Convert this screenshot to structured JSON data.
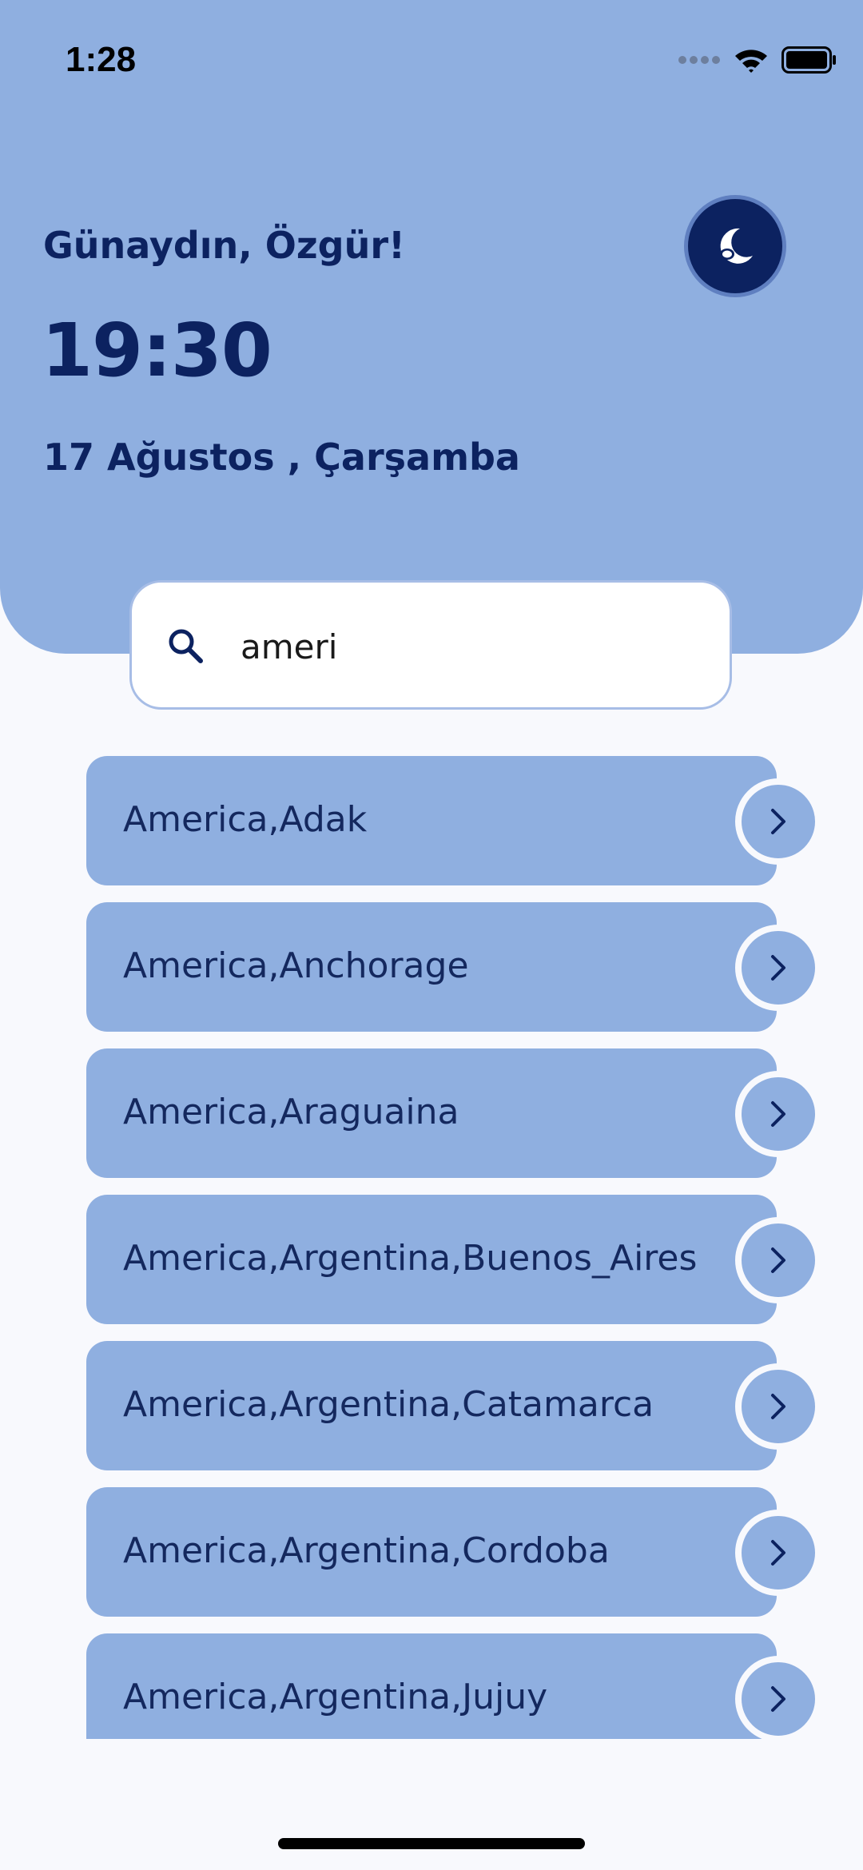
{
  "status_bar": {
    "time": "1:28"
  },
  "header": {
    "greeting": "Günaydın, Özgür!",
    "clock": "19:30",
    "date": "17 Ağustos , Çarşamba",
    "theme_toggle_icon": "moon-icon"
  },
  "search": {
    "value": "ameri",
    "icon": "search-icon"
  },
  "results": [
    {
      "label": "America,Adak"
    },
    {
      "label": "America,Anchorage"
    },
    {
      "label": "America,Araguaina"
    },
    {
      "label": "America,Argentina,Buenos_Aires"
    },
    {
      "label": "America,Argentina,Catamarca"
    },
    {
      "label": "America,Argentina,Cordoba"
    },
    {
      "label": "America,Argentina,Jujuy"
    }
  ],
  "colors": {
    "header_bg": "#8fafe0",
    "accent_dark": "#0c2260",
    "page_bg": "#f8f9fd",
    "card_bg": "#8fafe0"
  }
}
